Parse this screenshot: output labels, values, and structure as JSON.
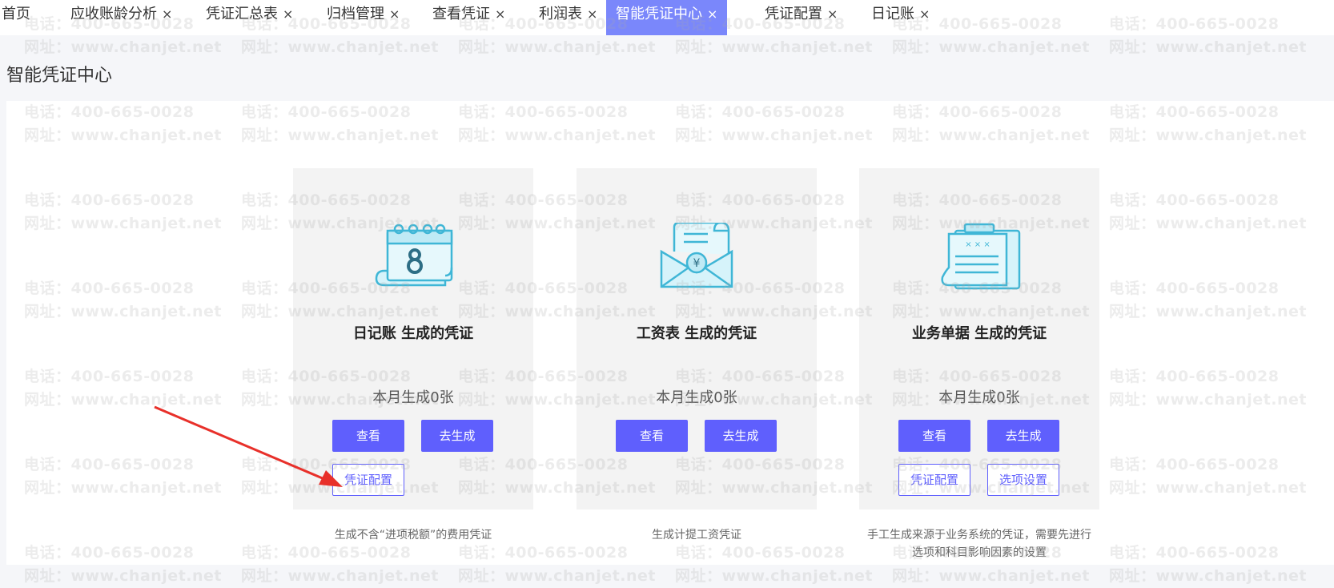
{
  "tabs": [
    {
      "label": "首页",
      "closable": false,
      "active": false
    },
    {
      "label": "应收账龄分析",
      "closable": true,
      "active": false
    },
    {
      "label": "凭证汇总表",
      "closable": true,
      "active": false
    },
    {
      "label": "归档管理",
      "closable": true,
      "active": false
    },
    {
      "label": "查看凭证",
      "closable": true,
      "active": false
    },
    {
      "label": "利润表",
      "closable": true,
      "active": false
    },
    {
      "label": "智能凭证中心",
      "closable": true,
      "active": true
    },
    {
      "label": "凭证配置",
      "closable": true,
      "active": false
    },
    {
      "label": "日记账",
      "closable": true,
      "active": false
    }
  ],
  "close_glyph": "×",
  "page_title": "智能凭证中心",
  "watermark": {
    "phone": "电话：400-665-0028",
    "site": "网址：www.chanjet.net"
  },
  "cards": [
    {
      "title": "日记账 生成的凭证",
      "count": "本月生成0张",
      "view_label": "查看",
      "generate_label": "去生成",
      "config_label": "凭证配置",
      "description": "生成不含“进项税额”的费用凭证",
      "icon": "calendar-icon"
    },
    {
      "title": "工资表 生成的凭证",
      "count": "本月生成0张",
      "view_label": "查看",
      "generate_label": "去生成",
      "description": "生成计提工资凭证",
      "icon": "salary-envelope-icon"
    },
    {
      "title": "业务单据 生成的凭证",
      "count": "本月生成0张",
      "view_label": "查看",
      "generate_label": "去生成",
      "config_label": "凭证配置",
      "options_label": "选项设置",
      "description_line1": "手工生成来源于业务系统的凭证，需要先进行",
      "description_line2": "选项和科目影响因素的设置",
      "icon": "document-clipboard-icon"
    }
  ],
  "colors": {
    "accent": "#5f5ffd",
    "active_tab": "#7a87fb",
    "arrow": "#e8302a",
    "icon_fill": "#d6f3fa",
    "icon_stroke": "#3fb6d6"
  }
}
